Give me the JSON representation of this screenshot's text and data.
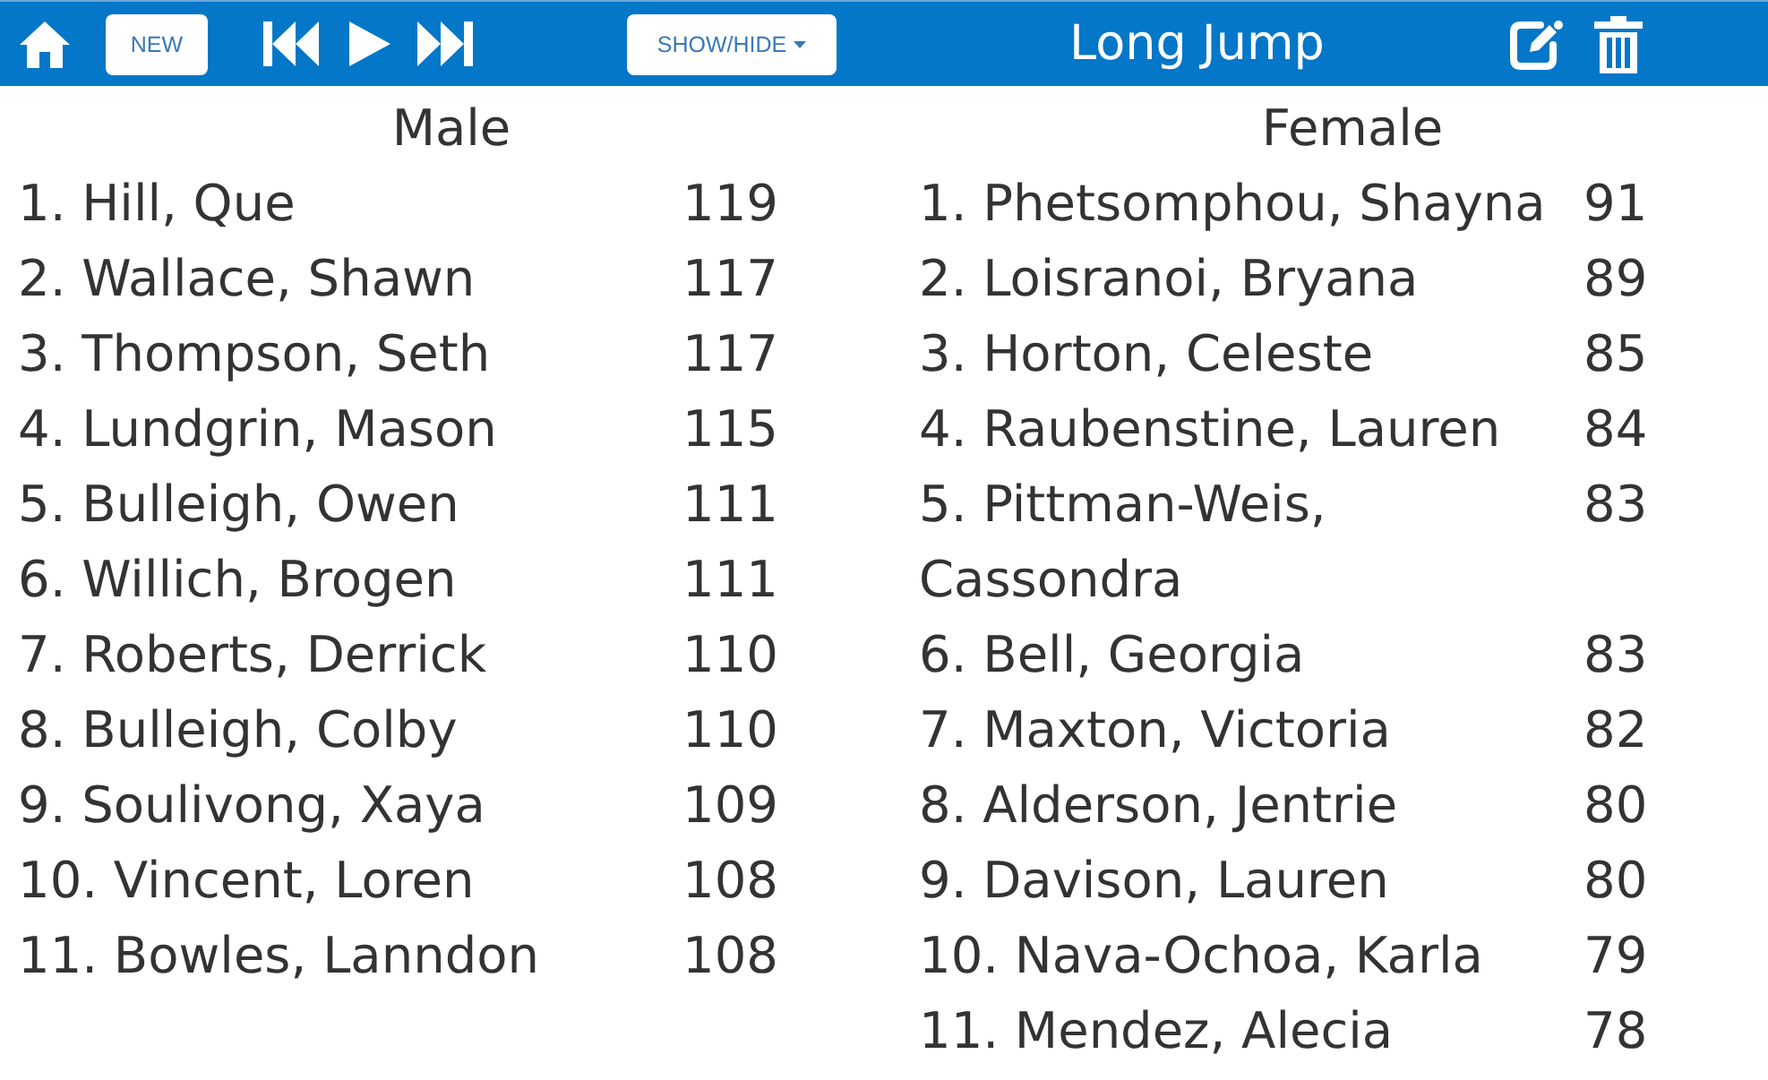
{
  "toolbar": {
    "new_button": "NEW",
    "show_hide_button": "SHOW/HIDE",
    "title": "Long Jump"
  },
  "sections": [
    {
      "heading": "Male",
      "entries": [
        {
          "name": "1. Hill, Que",
          "score": "119"
        },
        {
          "name": "2. Wallace, Shawn",
          "score": "117"
        },
        {
          "name": "3. Thompson, Seth",
          "score": "117"
        },
        {
          "name": "4. Lundgrin, Mason",
          "score": "115"
        },
        {
          "name": "5. Bulleigh, Owen",
          "score": "111"
        },
        {
          "name": "6. Willich, Brogen",
          "score": "111"
        },
        {
          "name": "7. Roberts, Derrick",
          "score": "110"
        },
        {
          "name": "8. Bulleigh, Colby",
          "score": "110"
        },
        {
          "name": "9. Soulivong, Xaya",
          "score": "109"
        },
        {
          "name": "10. Vincent, Loren",
          "score": "108"
        },
        {
          "name": "11. Bowles, Lanndon",
          "score": "108"
        }
      ]
    },
    {
      "heading": "Female",
      "entries": [
        {
          "name": "1. Phetsomphou, Shayna",
          "score": "91"
        },
        {
          "name": "2. Loisranoi, Bryana",
          "score": "89"
        },
        {
          "name": "3. Horton, Celeste",
          "score": "85"
        },
        {
          "name": "4. Raubenstine, Lauren",
          "score": "84"
        },
        {
          "name": "5. Pittman-Weis, Cassondra",
          "score": "83"
        },
        {
          "name": "6. Bell, Georgia",
          "score": "83"
        },
        {
          "name": "7. Maxton, Victoria",
          "score": "82"
        },
        {
          "name": "8. Alderson, Jentrie",
          "score": "80"
        },
        {
          "name": "9. Davison, Lauren",
          "score": "80"
        },
        {
          "name": "10. Nava-Ochoa, Karla",
          "score": "79"
        },
        {
          "name": "11. Mendez, Alecia",
          "score": "78"
        }
      ]
    }
  ]
}
